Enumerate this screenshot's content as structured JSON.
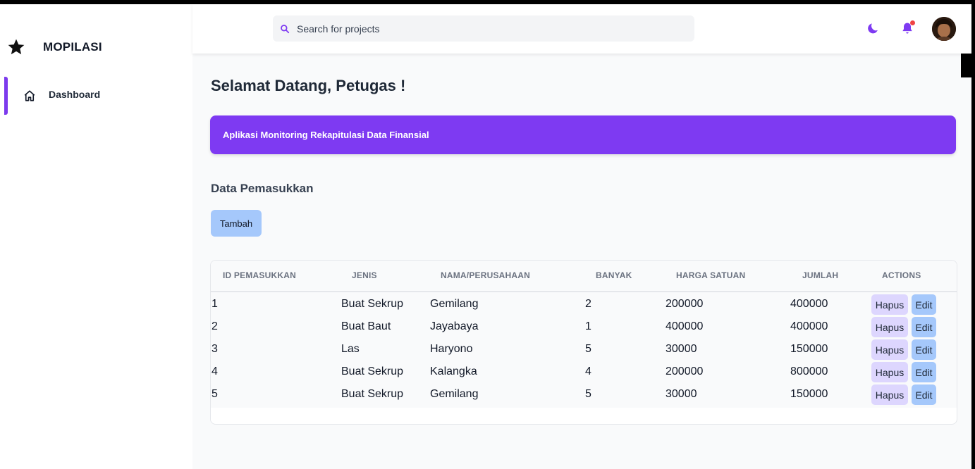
{
  "app": {
    "brand": "MOPILASI"
  },
  "sidebar": {
    "items": [
      {
        "label": "Dashboard",
        "icon": "home-icon",
        "active": true
      }
    ]
  },
  "header": {
    "search_placeholder": "Search for projects",
    "accent": "#7e3af2"
  },
  "main": {
    "title": "Selamat Datang, Petugas !",
    "banner": "Aplikasi Monitoring Rekapitulasi Data Finansial",
    "section_title": "Data Pemasukkan",
    "add_button": "Tambah",
    "table": {
      "columns": [
        "ID PEMASUKKAN",
        "JENIS",
        "NAMA/PERUSAHAAN",
        "BANYAK",
        "HARGA SATUAN",
        "JUMLAH",
        "ACTIONS"
      ],
      "rows": [
        {
          "id": "1",
          "jenis": "Buat Sekrup",
          "nama": "Gemilang",
          "banyak": "2",
          "harga": "200000",
          "jumlah": "400000"
        },
        {
          "id": "2",
          "jenis": "Buat Baut",
          "nama": "Jayabaya",
          "banyak": "1",
          "harga": "400000",
          "jumlah": "400000"
        },
        {
          "id": "3",
          "jenis": "Las",
          "nama": "Haryono",
          "banyak": "5",
          "harga": "30000",
          "jumlah": "150000"
        },
        {
          "id": "4",
          "jenis": "Buat Sekrup",
          "nama": "Kalangka",
          "banyak": "4",
          "harga": "200000",
          "jumlah": "800000"
        },
        {
          "id": "5",
          "jenis": "Buat Sekrup",
          "nama": "Gemilang",
          "banyak": "5",
          "harga": "30000",
          "jumlah": "150000"
        }
      ],
      "hapus_label": "Hapus",
      "edit_label": "Edit"
    }
  }
}
